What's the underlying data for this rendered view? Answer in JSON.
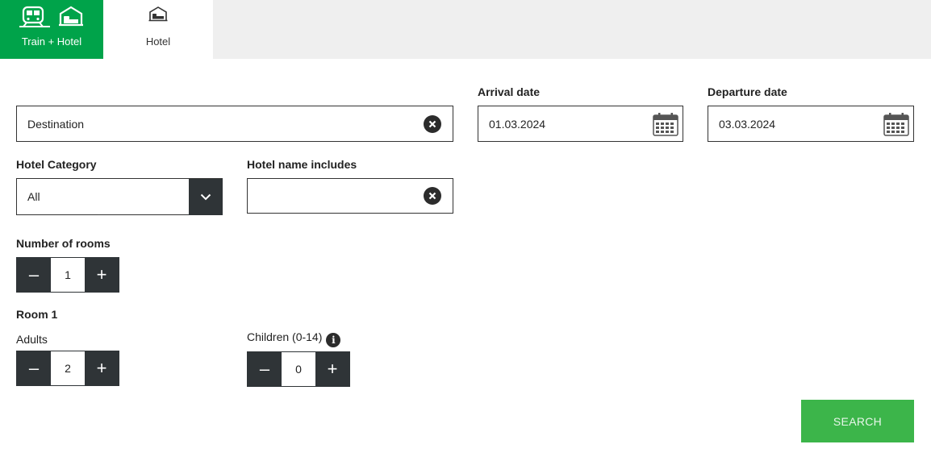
{
  "tabs": {
    "train_hotel": {
      "label": "Train + Hotel",
      "active": true,
      "icons": [
        "train-icon",
        "bed-icon"
      ]
    },
    "hotel": {
      "label": "Hotel",
      "active": false,
      "icons": [
        "bed-icon"
      ]
    }
  },
  "destination": {
    "value": "Destination"
  },
  "arrival": {
    "label": "Arrival date",
    "value": "01.03.2024"
  },
  "departure": {
    "label": "Departure date",
    "value": "03.03.2024"
  },
  "hotel_category": {
    "label": "Hotel Category",
    "selected": "All"
  },
  "hotel_name": {
    "label": "Hotel name includes",
    "value": ""
  },
  "rooms": {
    "label": "Number of rooms",
    "value": "1"
  },
  "room1": {
    "title": "Room 1",
    "adults": {
      "label": "Adults",
      "value": "2"
    },
    "children": {
      "label": "Children (0-14)",
      "value": "0"
    }
  },
  "stepper": {
    "minus": "–",
    "plus": "+"
  },
  "search": {
    "label": "SEARCH"
  },
  "colors": {
    "primary_green": "#00a34a",
    "search_green": "#3cb54a",
    "dark_control": "#2f3437",
    "tab_bar_bg": "#efefef"
  }
}
